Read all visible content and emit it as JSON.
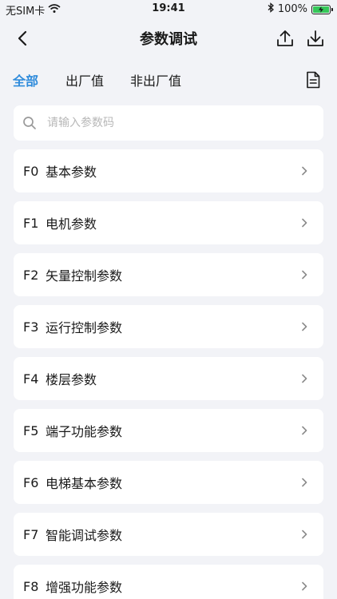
{
  "status_bar": {
    "carrier": "无SIM卡",
    "time": "19:41",
    "battery_percent": "100%",
    "battery_level": 1.0,
    "icons": [
      "wifi-icon",
      "bluetooth-icon",
      "battery-icon"
    ]
  },
  "nav": {
    "title": "参数调试",
    "back_icon": "chevron-left-icon",
    "upload_icon": "upload-icon",
    "download_icon": "download-icon"
  },
  "tabs": [
    {
      "label": "全部",
      "active": true
    },
    {
      "label": "出厂值",
      "active": false
    },
    {
      "label": "非出厂值",
      "active": false
    }
  ],
  "tabs_right_icon": "document-icon",
  "search": {
    "placeholder": "请输入参数码",
    "value": ""
  },
  "params": [
    {
      "code": "F0",
      "label": "基本参数"
    },
    {
      "code": "F1",
      "label": "电机参数"
    },
    {
      "code": "F2",
      "label": "矢量控制参数"
    },
    {
      "code": "F3",
      "label": "运行控制参数"
    },
    {
      "code": "F4",
      "label": "楼层参数"
    },
    {
      "code": "F5",
      "label": "端子功能参数"
    },
    {
      "code": "F6",
      "label": "电梯基本参数"
    },
    {
      "code": "F7",
      "label": "智能调试参数"
    },
    {
      "code": "F8",
      "label": "增强功能参数"
    }
  ],
  "colors": {
    "accent": "#2f8bdb",
    "background": "#f2f3f7",
    "card": "#ffffff",
    "battery": "#35c759"
  }
}
